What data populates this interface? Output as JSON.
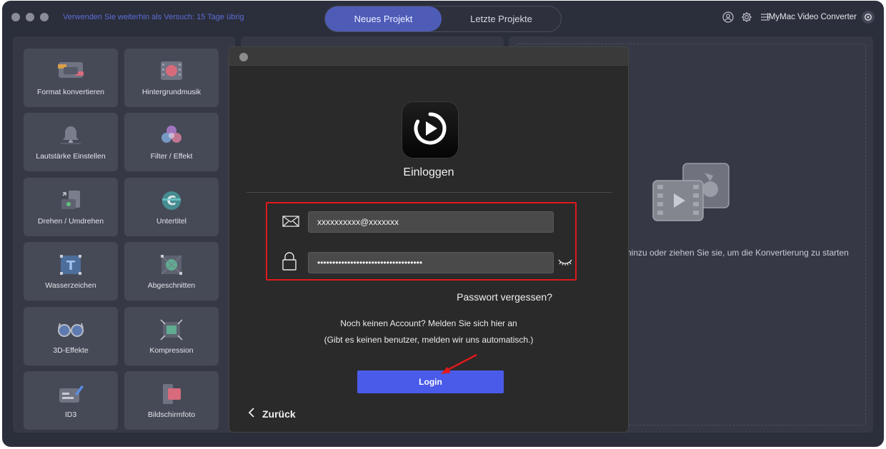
{
  "titlebar": {
    "trial_notice": "Verwenden Sie weiterhin als Versuch: 15 Tage übrig",
    "tabs": [
      {
        "label": "Neues Projekt",
        "active": true
      },
      {
        "label": "Letzte Projekte",
        "active": false
      }
    ],
    "app_name": "iMyMac Video Converter",
    "icons": [
      "user-icon",
      "gear-icon",
      "menu-icon",
      "app-logo-icon"
    ]
  },
  "tools": [
    {
      "label": "Format konvertieren",
      "icon": "format-convert-icon"
    },
    {
      "label": "Hintergrundmusik",
      "icon": "background-music-icon"
    },
    {
      "label": "Lautstärke Einstellen",
      "icon": "volume-bell-icon"
    },
    {
      "label": "Filter / Effekt",
      "icon": "filter-icon"
    },
    {
      "label": "Drehen / Umdrehen",
      "icon": "rotate-icon"
    },
    {
      "label": "Untertitel",
      "icon": "subtitle-icon"
    },
    {
      "label": "Wasserzeichen",
      "icon": "watermark-icon"
    },
    {
      "label": "Abgeschnitten",
      "icon": "crop-icon"
    },
    {
      "label": "3D-Effekte",
      "icon": "3d-glasses-icon"
    },
    {
      "label": "Kompression",
      "icon": "compress-icon"
    },
    {
      "label": "ID3",
      "icon": "id3-icon"
    },
    {
      "label": "Bildschirmfoto",
      "icon": "screenshot-icon"
    }
  ],
  "dropzone": {
    "text": "hinzu oder ziehen Sie sie, um die Konvertierung zu starten"
  },
  "login": {
    "title": "Einloggen",
    "email_value": "xxxxxxxxxx@xxxxxxx",
    "password_value": "•••••••••••••••••••••••••••••••••••",
    "forgot_label": "Passwort vergessen?",
    "no_account": "Noch keinen Account? Melden Sie sich hier an",
    "auto_note": "(Gibt es keinen benutzer, melden wir uns automatisch.)",
    "login_label": "Login",
    "back_label": "Zurück"
  },
  "colors": {
    "accent": "#4a5bea",
    "highlight": "#e0191b",
    "trial_text": "#5c6ed6",
    "window_bg": "#2b2e3b"
  }
}
